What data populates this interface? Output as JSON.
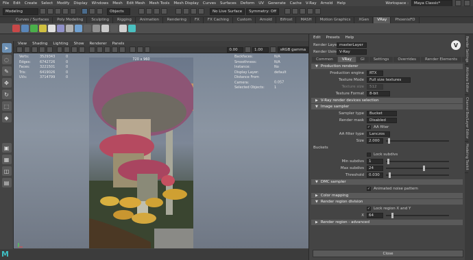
{
  "menubar": {
    "items": [
      "File",
      "Edit",
      "Create",
      "Select",
      "Modify",
      "Display",
      "Windows",
      "Mesh",
      "Edit Mesh",
      "Mesh Tools",
      "Mesh Display",
      "Curves",
      "Surfaces",
      "Deform",
      "UV",
      "Generate",
      "Cache",
      "V-Ray",
      "Arnold",
      "Help"
    ],
    "workspace_label": "Workspace :",
    "workspace_value": "Maya Classic*"
  },
  "statusline": {
    "mode": "Modeling",
    "objects": "Objects",
    "live_surface": "No Live Surface",
    "symmetry": "Symmetry: Off"
  },
  "shelf": {
    "tabs": [
      "Curves / Surfaces",
      "Poly Modeling",
      "Sculpting",
      "Rigging",
      "Animation",
      "Rendering",
      "FX",
      "FX Caching",
      "Custom",
      "Arnold",
      "Bifrost",
      "MASH",
      "Motion Graphics",
      "XGen",
      "VRay",
      "PhoenixFD"
    ],
    "active": "VRay"
  },
  "viewport": {
    "menu": [
      "View",
      "Shading",
      "Lighting",
      "Show",
      "Renderer",
      "Panels"
    ],
    "exposure": "0.00",
    "gamma": "1.00",
    "colorspace": "sRGB gamma",
    "resolution": "720 x 960",
    "hud_left": [
      {
        "k": "Verts:",
        "v": "3529343"
      },
      {
        "k": "Edges:",
        "v": "6742726"
      },
      {
        "k": "Faces:",
        "v": "3221501"
      },
      {
        "k": "Tris:",
        "v": "6419026"
      },
      {
        "k": "UVs:",
        "v": "3714799"
      }
    ],
    "hud_mid": [
      "0",
      "0",
      "0",
      "0",
      "0"
    ],
    "hud_right": [
      {
        "k": "Backfaces:",
        "v": "N/A"
      },
      {
        "k": "Smoothness:",
        "v": "N/A"
      },
      {
        "k": "Instance:",
        "v": "No"
      },
      {
        "k": "Display Layer:",
        "v": "default"
      },
      {
        "k": "Distance From Camera:",
        "v": "0.057"
      },
      {
        "k": "Selected Objects:",
        "v": "1"
      }
    ]
  },
  "render_settings": {
    "menu": [
      "Edit",
      "Presets",
      "Help"
    ],
    "render_layer_label": "Render Layer",
    "render_layer": "masterLayer",
    "render_using_label": "Render Using",
    "render_using": "V-Ray",
    "tabs": [
      "Common",
      "VRay",
      "GI",
      "Settings",
      "Overrides",
      "Render Elements",
      "IPR"
    ],
    "active_tab": "VRay",
    "sections": {
      "production_renderer": "Production renderer",
      "devices": "V-Ray render devices selection",
      "image_sampler": "Image sampler",
      "dmc": "DMC sampler",
      "color_mapping": "Color mapping",
      "render_region": "Render region division",
      "render_region_adv": "Render region - advanced"
    },
    "production_engine_label": "Production engine",
    "production_engine": "RTX",
    "texture_mode_label": "Texture Mode",
    "texture_mode": "Full size textures",
    "texture_size_label": "Texture size",
    "texture_size": "512",
    "texture_format_label": "Texture Format",
    "texture_format": "8-bit",
    "sampler_type_label": "Sampler type",
    "sampler_type": "Bucket",
    "render_mask_label": "Render mask",
    "render_mask": "Disabled",
    "aa_filter_label": "AA filter",
    "aa_filter_type_label": "AA filter type",
    "aa_filter_type": "Lanczos",
    "size_label": "Size",
    "size": "2.000",
    "buckets_label": "Buckets",
    "lock_subdivs_label": "Lock subdivs",
    "min_subdivs_label": "Min subdivs",
    "min_subdivs": "1",
    "max_subdivs_label": "Max subdivs",
    "max_subdivs": "24",
    "threshold_label": "Threshold",
    "threshold": "0.030",
    "animated_noise_label": "Animated noise pattern",
    "lock_region_label": "Lock region X and Y",
    "x_label": "X",
    "x_value": "64",
    "close": "Close"
  },
  "sidetabs": [
    "Render Settings",
    "Attribute Editor",
    "Channel Box/Layer Editor",
    "Modeling Toolkit"
  ]
}
